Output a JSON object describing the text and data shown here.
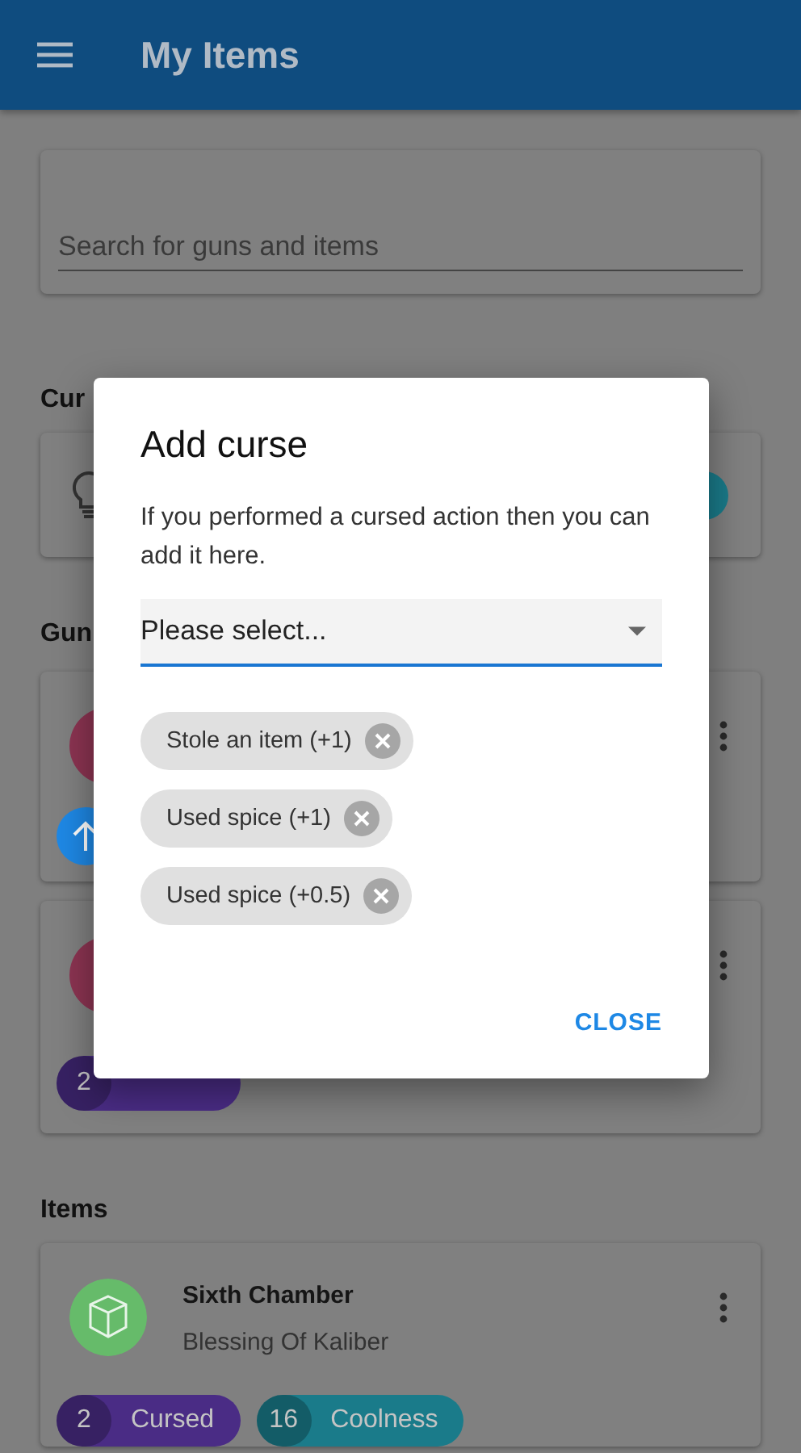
{
  "app_bar": {
    "title": "My Items"
  },
  "search": {
    "placeholder": "Search for guns and items"
  },
  "curses_section": {
    "heading": "Cur"
  },
  "guns_section": {
    "heading": "Gun",
    "cards": [
      {
        "kind": "icon"
      },
      {
        "kind": "chips",
        "chips": [
          {
            "count": "2",
            "color": "#4a2c85"
          }
        ]
      }
    ]
  },
  "items_section": {
    "heading": "Items",
    "items": [
      {
        "title": "Sixth Chamber",
        "subtitle": "Blessing Of Kaliber",
        "chips": [
          {
            "count": "2",
            "label": "Cursed",
            "color": "#4a2c85"
          },
          {
            "count": "16",
            "label": "Coolness",
            "color": "#1a7b8a"
          }
        ]
      }
    ]
  },
  "dialog": {
    "title": "Add curse",
    "text": "If you performed a cursed action then you can add it here.",
    "select": {
      "value": "Please select..."
    },
    "chips": [
      "Stole an item (+1)",
      "Used spice (+1)",
      "Used spice (+0.5)"
    ],
    "button": "CLOSE"
  }
}
